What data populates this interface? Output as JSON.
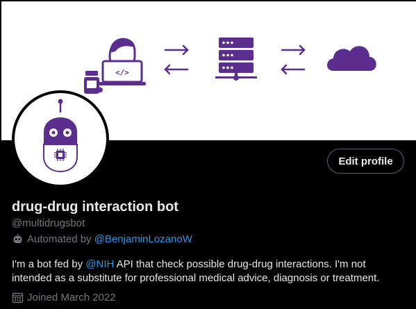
{
  "profile": {
    "display_name": "drug-drug interaction bot",
    "handle": "@multidrugsbot",
    "automated_prefix": "Automated by",
    "automated_by": "@BenjaminLozanoW",
    "bio_part1": "I'm a bot fed by",
    "bio_mention": "@NIH",
    "bio_part2": "API that check possible drug-drug interactions.  I'm not intended as a substitute for professional medical advice, diagnosis or treatment.",
    "joined": "Joined March 2022"
  },
  "actions": {
    "edit_profile_label": "Edit profile"
  },
  "banner": {
    "code_glyph": "</>",
    "icons": [
      "pill-bottle-icon",
      "developer-at-laptop-icon",
      "arrows-exchange-icon",
      "server-icon",
      "arrows-exchange-icon",
      "cloud-icon"
    ]
  },
  "colors": {
    "brand_purple": "#5b2d8e",
    "link_blue": "#1d9bf0",
    "background": "#000000",
    "secondary_text": "#71767b"
  }
}
